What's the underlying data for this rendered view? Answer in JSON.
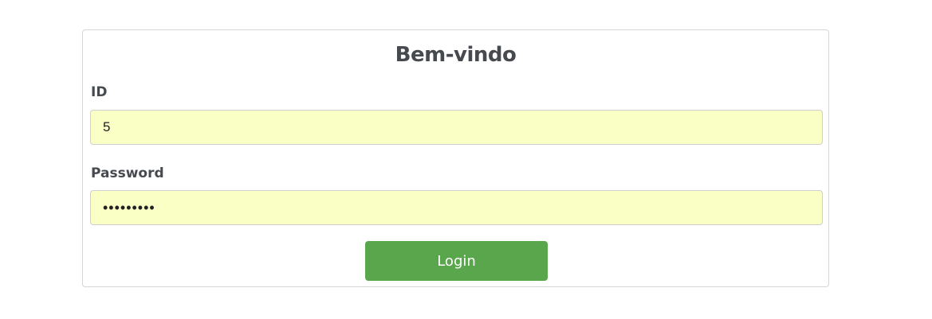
{
  "form": {
    "title": "Bem-vindo",
    "id_label": "ID",
    "id_value": "5",
    "password_label": "Password",
    "password_value": "•••••••••",
    "login_label": "Login"
  },
  "colors": {
    "field_background": "#faffc6",
    "button_background": "#59a64d",
    "heading_text": "#464a4f"
  }
}
